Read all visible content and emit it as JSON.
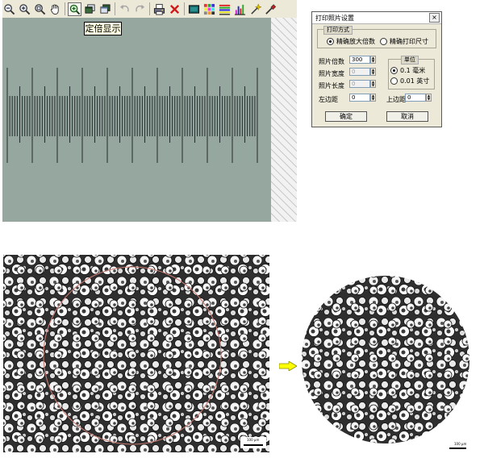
{
  "toolbar": {
    "icons": [
      "zoom-out-icon",
      "zoom-in-icon",
      "zoom-fit-icon",
      "hand-pan-icon",
      "calibrated-zoom-icon",
      "copy-window-icon",
      "paste-window-icon",
      "undo-icon",
      "redo-icon",
      "print-icon",
      "delete-icon",
      "frame-icon",
      "color-grid-icon",
      "stripe-icon",
      "histogram-icon",
      "wand-icon",
      "eyedropper-icon"
    ]
  },
  "tooltip": "定倍显示",
  "dialog": {
    "title": "打印照片设置",
    "print_mode_group": "打印方式",
    "mode_exact_magnification": "精确放大倍数",
    "mode_exact_print_size": "精确打印尺寸",
    "photo_magnification_label": "照片倍数",
    "photo_magnification_value": "300",
    "photo_width_label": "照片宽度",
    "photo_width_value": "0",
    "photo_length_label": "照片长度",
    "photo_length_value": "0",
    "unit_group": "单位",
    "unit_mm": "0.1 毫米",
    "unit_inch": "0.01 英寸",
    "left_margin_label": "左边距",
    "left_margin_value": "0",
    "top_margin_label": "上边距",
    "top_margin_value": "0",
    "ok_label": "确定",
    "cancel_label": "取消"
  },
  "scale_bar_left": "100 µm",
  "scale_bar_right": "100 µm",
  "colors": {
    "toolbar_bg": "#ece9d8",
    "view_bg": "#96a7a0",
    "ruler_line": "#2b3434",
    "circle_outline": "#c77a72",
    "arrow_fill": "#ffff00"
  }
}
